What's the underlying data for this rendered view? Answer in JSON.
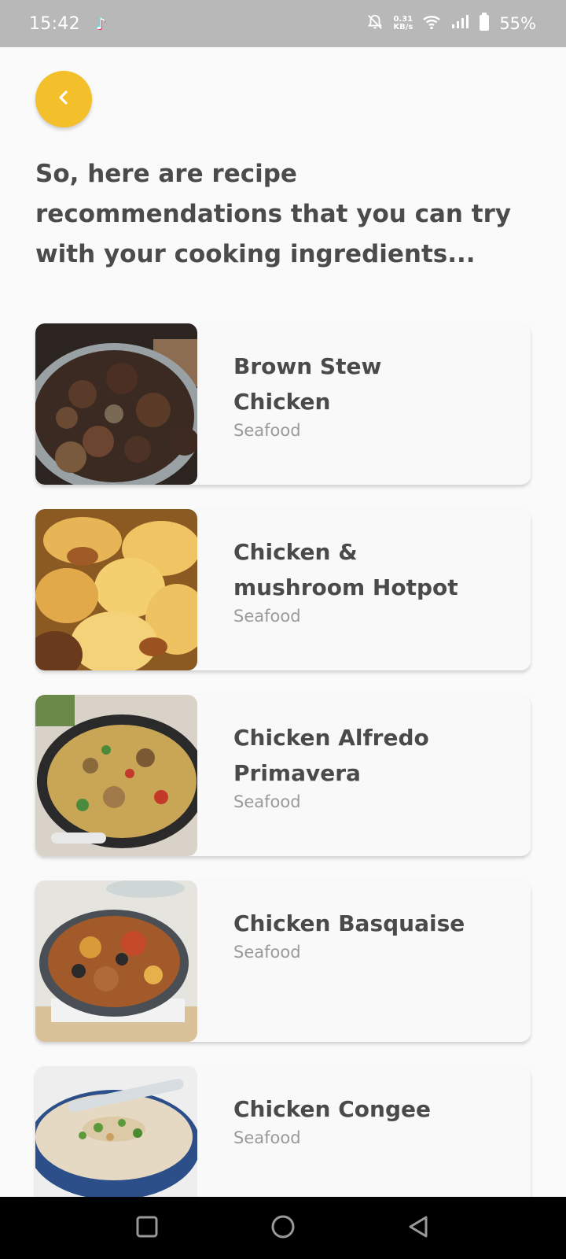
{
  "status_bar": {
    "time": "15:42",
    "app_icon": "tiktok-icon",
    "net_speed_value": "0.31",
    "net_speed_unit": "KB/s",
    "battery": "55%",
    "icons": [
      "bell-off-icon",
      "wifi-icon",
      "signal-icon",
      "battery-icon"
    ]
  },
  "header": {
    "back_icon": "chevron-left-icon",
    "accent_color": "#f3bf2a",
    "title": "So, here are recipe recommendations that you can try with your cooking ingredients..."
  },
  "recipes": [
    {
      "name": "Brown Stew Chicken",
      "category": "Seafood",
      "image": "brown-stew-chicken-photo"
    },
    {
      "name": "Chicken & mushroom Hotpot",
      "category": "Seafood",
      "image": "hotpot-photo"
    },
    {
      "name": "Chicken Alfredo Primavera",
      "category": "Seafood",
      "image": "alfredo-pasta-photo"
    },
    {
      "name": "Chicken Basquaise",
      "category": "Seafood",
      "image": "basquaise-photo"
    },
    {
      "name": "Chicken Congee",
      "category": "Seafood",
      "image": "congee-photo"
    }
  ],
  "nav_bar": {
    "buttons": [
      "recents-square-icon",
      "home-circle-icon",
      "back-triangle-icon"
    ]
  }
}
